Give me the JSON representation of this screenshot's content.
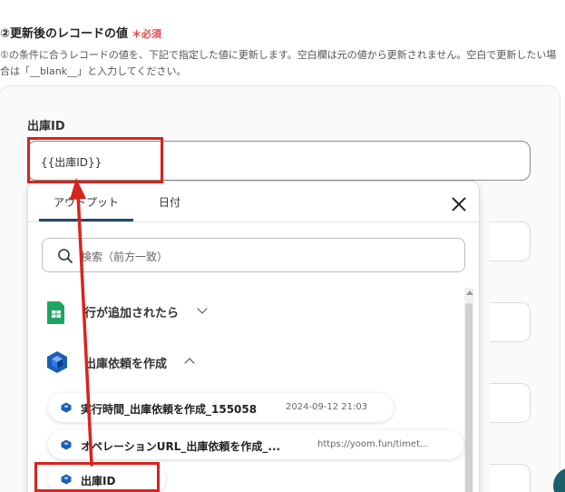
{
  "section": {
    "title": "②更新後のレコードの値",
    "required_mark": "＊必須",
    "description": "①の条件に合うレコードの値を、下記で指定した値に更新します。空白欄は元の値から更新されません。空白で更新したい場合は「__blank__」と入力してください。"
  },
  "field": {
    "label": "出庫ID",
    "value": "{{出庫ID}}"
  },
  "popover": {
    "tabs": [
      {
        "label": "アウトプット",
        "active": true
      },
      {
        "label": "日付",
        "active": false
      }
    ],
    "search_placeholder": "検索（前方一致）",
    "groups": [
      {
        "label": "行が追加されたら",
        "icon": "google-sheets-icon",
        "expanded": false
      },
      {
        "label": "出庫依頼を作成",
        "icon": "cube-app-icon",
        "expanded": true
      }
    ],
    "items": [
      {
        "name": "実行時間_出庫依頼を作成_155058",
        "value": "2024-09-12 21:03"
      },
      {
        "name": "オペレーションURL_出庫依頼を作成_...",
        "value": "https://yoom.fun/timet..."
      },
      {
        "name": "出庫ID",
        "value": ""
      }
    ]
  },
  "colors": {
    "highlight": "#d9231d",
    "tab_underline": "#1f4b6e",
    "sheets_green": "#1fa463",
    "cube_blue": "#1a5fb4"
  }
}
